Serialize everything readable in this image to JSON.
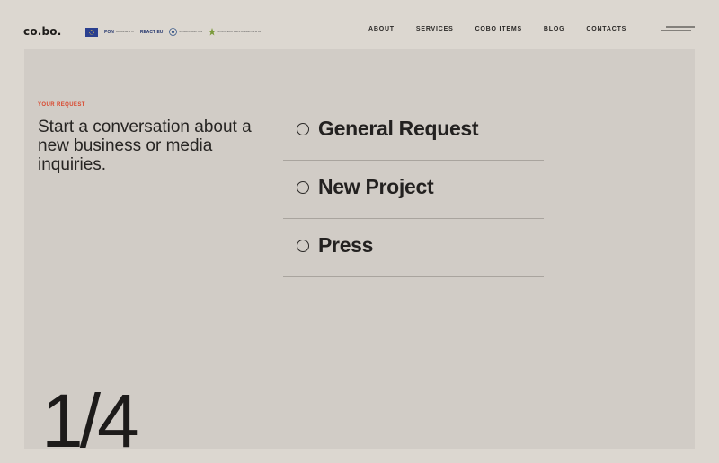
{
  "header": {
    "logo": "co.bo.",
    "partners": [
      {
        "name": "eu-flag-logo",
        "text": ""
      },
      {
        "name": "pon-logo",
        "text": "PON",
        "sub": "IMPRESE E COMPETITIVITÀ"
      },
      {
        "name": "react-eu-logo",
        "text": "REACT EU",
        "sub": ""
      },
      {
        "name": "italy-ministry-logo",
        "text": "",
        "sub": "Ministero dello Sviluppo Economico"
      },
      {
        "name": "ministry-environment-logo",
        "text": "",
        "sub": "MINISTERO DELL'AMBIENTE E DELLA SICUREZZA ENERGETICA"
      }
    ],
    "nav": [
      "ABOUT",
      "SERVICES",
      "COBO ITEMS",
      "BLOG",
      "CONTACTS"
    ]
  },
  "main": {
    "eyebrow": "YOUR REQUEST",
    "headline": "Start a conversation about a new business or media inquiries.",
    "options": [
      "General Request",
      "New Project",
      "Press"
    ],
    "step_indicator": "1/4"
  },
  "colors": {
    "page_bg": "#dcd7d0",
    "panel_bg": "#d1ccc6",
    "accent": "#d9452b",
    "text": "#1e1c1a"
  }
}
